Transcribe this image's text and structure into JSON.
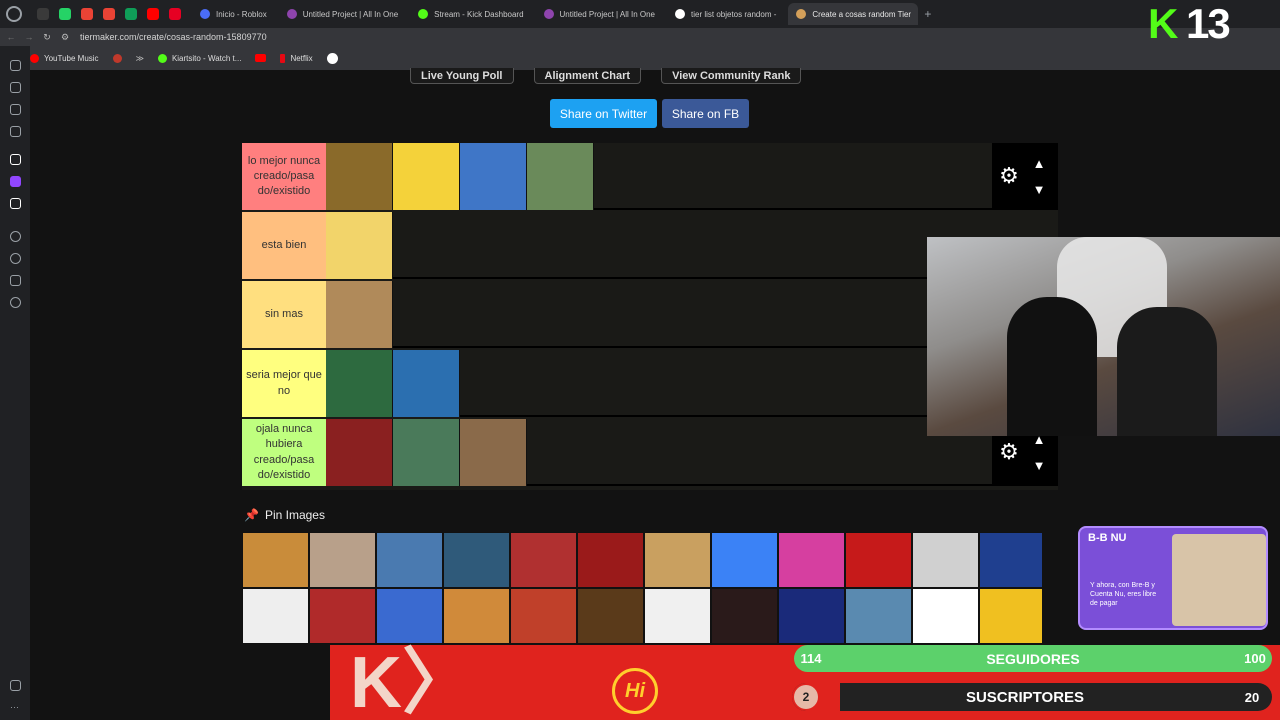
{
  "browser": {
    "tabs": [
      {
        "label": "Inicio - Roblox",
        "color": "#4a6cf7"
      },
      {
        "label": "Untitled Project | All In One",
        "color": "#8e44ad"
      },
      {
        "label": "Stream - Kick Dashboard",
        "color": "#53fc18"
      },
      {
        "label": "Untitled Project | All In One",
        "color": "#8e44ad"
      },
      {
        "label": "tier list objetos random -",
        "color": "#ffffff"
      },
      {
        "label": "Create a cosas random Tier",
        "color": "#d4a05a",
        "active": true
      }
    ],
    "url": "tiermaker.com/create/cosas-random-15809770",
    "bookmarks": [
      {
        "label": "YouTube Music",
        "color": "#ff0000"
      },
      {
        "label": "Kiartsito - Watch t...",
        "color": "#53fc18"
      },
      {
        "label": "Netflix",
        "color": "#e50914"
      }
    ]
  },
  "page": {
    "top_buttons": [
      "Live Young Poll",
      "Alignment Chart",
      "View Community Rank"
    ],
    "share_twitter": "Share on Twitter",
    "share_fb": "Share on FB",
    "tiers": [
      {
        "label": "lo mejor nunca creado/pasa do/existido",
        "color": "#ff7f7f",
        "images": [
          "#8a6a2a",
          "#f4d23a",
          "#3f76c7",
          "#6a8a5a"
        ]
      },
      {
        "label": "esta bien",
        "color": "#ffbf7f",
        "images": [
          "#f2d46a"
        ]
      },
      {
        "label": "sin mas",
        "color": "#ffdf7f",
        "images": [
          "#b08a5a"
        ]
      },
      {
        "label": "seria mejor que no",
        "color": "#ffff7f",
        "images": [
          "#2d6a3f",
          "#2b6fb0"
        ]
      },
      {
        "label": "ojala nunca hubiera creado/pasa do/existido",
        "color": "#bfff7f",
        "images": [
          "#8a2020",
          "#4a7a5a",
          "#8a6a4a"
        ]
      }
    ],
    "pin_title": "Pin Images",
    "pin_images": [
      "#c98c3a",
      "#b8a08a",
      "#4a7ab0",
      "#2f5a7a",
      "#b03030",
      "#9a1a1a",
      "#c9a060",
      "#3b82f6",
      "#d63fa0",
      "#c61a1a",
      "#d0d0d0",
      "#1f3f8f",
      "#eeeeee",
      "#b02a2a",
      "#3a6ad0",
      "#d08a3a",
      "#c0402a",
      "#5a3a1a",
      "#f0f0f0",
      "#2a1a1a",
      "#1a2a7a",
      "#5a8ab0",
      "#ffffff",
      "#f0c020"
    ]
  },
  "overlay": {
    "kick_badge_k": "K",
    "kick_badge_num": "13",
    "promo_logo": "B-B NU",
    "promo_text": "Y ahora, con Bre-B y Cuenta Nu, eres libre de pagar",
    "hi_logo": "Hi",
    "followers": {
      "current": "114",
      "label": "SEGUIDORES",
      "goal": "100",
      "progress": 1.0
    },
    "subs": {
      "current": "2",
      "label": "SUSCRIPTORES",
      "goal": "20",
      "progress": 0.1
    }
  }
}
